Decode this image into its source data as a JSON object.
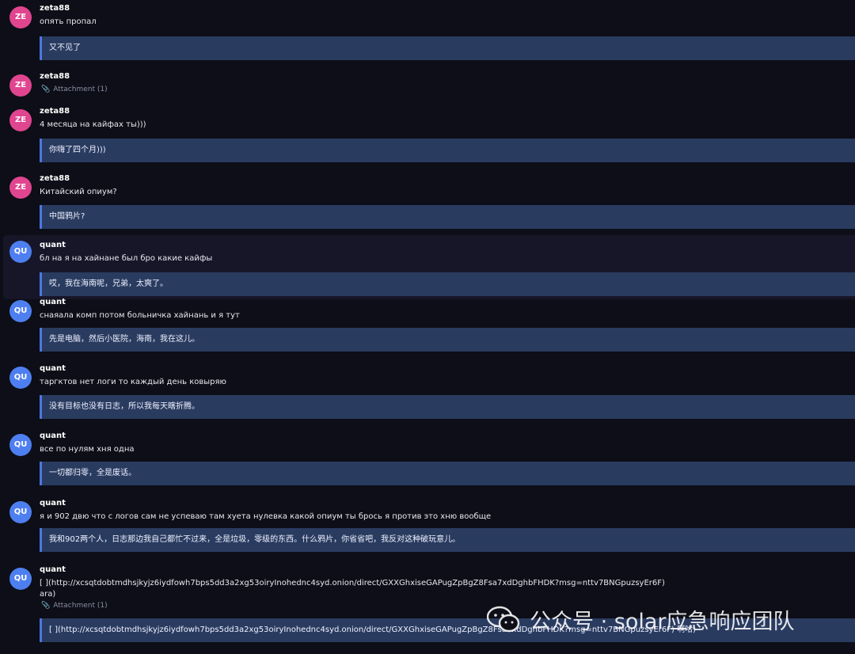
{
  "messages": [
    {
      "user": "zeta88",
      "avatar": "ZE",
      "text": "опять пропал",
      "translation": "又不见了"
    },
    {
      "user": "zeta88",
      "avatar": "ZE",
      "attachment": "Attachment (1)"
    },
    {
      "user": "zeta88",
      "avatar": "ZE",
      "text": "4 месяца на кайфах ты)))",
      "translation": "你嗨了四个月)))"
    },
    {
      "user": "zeta88",
      "avatar": "ZE",
      "text": "Китайский опиум?",
      "translation": "中国鸦片?"
    },
    {
      "user": "quant",
      "avatar": "QU",
      "text": "бл на я на хайнане был бро какие кайфы",
      "translation": "哎，我在海南呢，兄弟，太爽了。"
    },
    {
      "user": "quant",
      "avatar": "QU",
      "text": "снаяала комп потом больничка хайнань и я тут",
      "translation": "先是电脑，然后小医院，海南，我在这儿。"
    },
    {
      "user": "quant",
      "avatar": "QU",
      "text": "таргктов нет логи то каждый день ковыряю",
      "translation": "没有目标也没有日志，所以我每天瞎折腾。"
    },
    {
      "user": "quant",
      "avatar": "QU",
      "text": "все по нулям хня одна",
      "translation": "一切都归零，全是废话。"
    },
    {
      "user": "quant",
      "avatar": "QU",
      "text": "я и 902 двю что с логов сам не успеваю там хуета нулевка какой опиум ты брось я против это хню вообще",
      "translation": "我和902两个人，日志那边我自己都忙不过来，全是垃圾，零级的东西。什么鸦片，你省省吧，我反对这种破玩意儿。"
    },
    {
      "user": "quant",
      "avatar": "QU",
      "text": "[ ](http://xcsqtdobtmdhsjkyjz6iydfowh7bps5dd3a2xg53oiryInohednc4syd.onion/direct/GXXGhxiseGAPugZpBgZ8Fsa7xdDghbFHDK?msg=nttv7BNGpuzsyEr6F)\nara)",
      "attachment": "Attachment (1)",
      "translation": "[ ](http://xcsqtdobtmdhsjkyjz6iydfowh7bps5dd3a2xg53oiryInohednc4syd.onion/direct/GXXGhxiseGAPugZpBgZ8Fsa7xdDghbFHDK?msg=nttv7BNGpuzsyEr6F) 啊哈)"
    }
  ],
  "watermark": {
    "text": "公众号 · solar应急响应团队",
    "icon": "wechat-icon"
  },
  "colors": {
    "zeta_avatar": "#e0458f",
    "quant_avatar": "#4e7ff0",
    "translation_bg": "#2a3b60",
    "background": "#0d0e17"
  }
}
